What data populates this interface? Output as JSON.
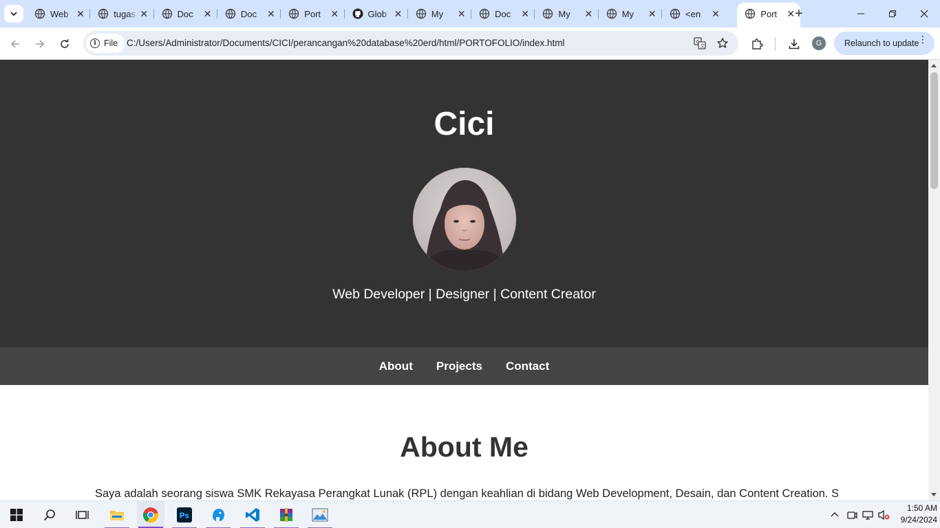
{
  "browser": {
    "tabs": [
      {
        "label": "Web",
        "icon": "globe-icon"
      },
      {
        "label": "tugas",
        "icon": "globe-icon"
      },
      {
        "label": "Doc",
        "icon": "globe-icon"
      },
      {
        "label": "Doc",
        "icon": "globe-icon"
      },
      {
        "label": "Port",
        "icon": "globe-icon"
      },
      {
        "label": "Glob",
        "icon": "github-icon"
      },
      {
        "label": "My",
        "icon": "globe-icon"
      },
      {
        "label": "Doc",
        "icon": "globe-icon"
      },
      {
        "label": "My",
        "icon": "globe-icon"
      },
      {
        "label": "My",
        "icon": "globe-icon"
      },
      {
        "label": "<en",
        "icon": "globe-icon"
      },
      {
        "label": "Port",
        "icon": "globe-icon",
        "active": true
      }
    ],
    "site_chip": "File",
    "url": "C:/Users/Administrator/Documents/CICI/perancangan%20database%20erd/html/PORTOFOLIO/index.html",
    "relaunch_label": "Relaunch to update",
    "profile_initial": "G"
  },
  "page": {
    "name": "Cici",
    "role": "Web Developer | Designer | Content Creator",
    "nav": [
      "About",
      "Projects",
      "Contact"
    ],
    "about_title": "About Me",
    "about_text": "Saya adalah seorang siswa SMK Rekayasa Perangkat Lunak (RPL) dengan keahlian di bidang Web Development, Desain, dan Content Creation. Saya",
    "colors": {
      "hero_bg": "#333333",
      "nav_bg": "#444444",
      "text_light": "#ffffff"
    }
  },
  "taskbar": {
    "apps": [
      "windows-start-icon",
      "search-icon",
      "task-view-icon",
      "file-explorer-icon",
      "chrome-icon",
      "photoshop-icon",
      "app-icon",
      "vscode-icon",
      "winrar-icon",
      "photo-viewer-icon"
    ],
    "time": "1:50 AM",
    "date": "9/24/2024"
  }
}
